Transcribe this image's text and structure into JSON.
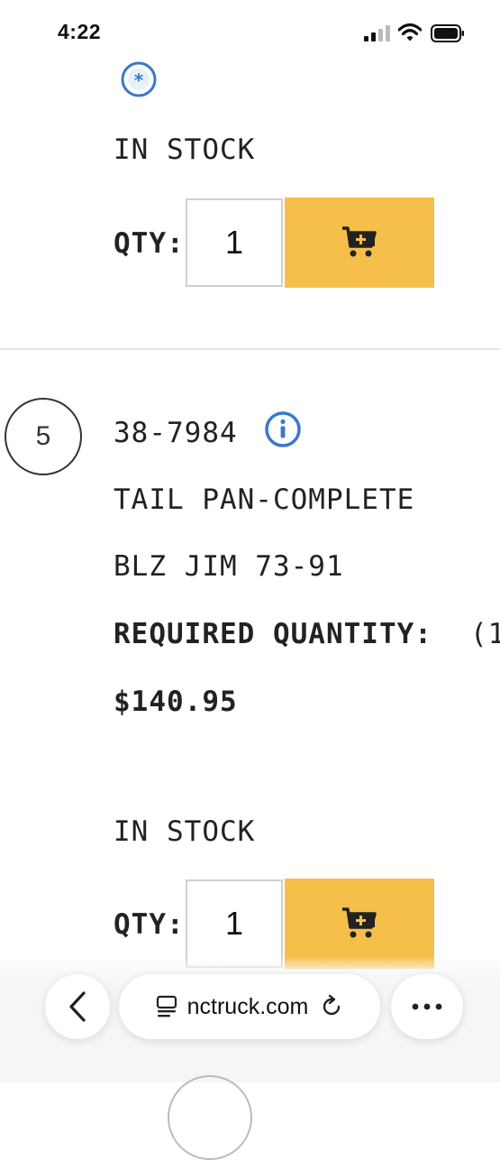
{
  "status_bar": {
    "time": "4:22"
  },
  "item_top": {
    "stock_status": "IN STOCK",
    "qty_label": "QTY:",
    "qty_value": "1"
  },
  "item_5": {
    "index": "5",
    "part_number": "38-7984",
    "description": "TAIL PAN-COMPLETE",
    "fitment": "BLZ JIM 73-91",
    "required_label": "REQUIRED QUANTITY:",
    "required_value": "(1",
    "price": "$140.95",
    "stock_status": "IN STOCK",
    "qty_label": "QTY:",
    "qty_value": "1"
  },
  "browser": {
    "url": "nctruck.com"
  },
  "colors": {
    "accent": "#f5bf49",
    "info_blue": "#3a78c9"
  },
  "icons": [
    "asterisk-badge-icon",
    "info-icon",
    "add-to-cart-icon",
    "back-chevron-icon",
    "reader-icon",
    "reload-icon",
    "more-icon"
  ]
}
